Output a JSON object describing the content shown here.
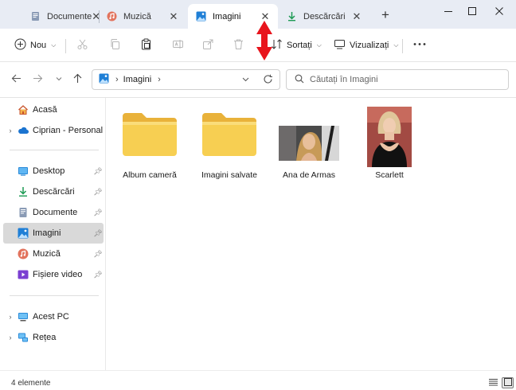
{
  "tabs": [
    {
      "label": "Documente",
      "icon": "documents-icon",
      "active": false
    },
    {
      "label": "Muzică",
      "icon": "music-icon",
      "active": false
    },
    {
      "label": "Imagini",
      "icon": "pictures-icon",
      "active": true
    },
    {
      "label": "Descărcări",
      "icon": "downloads-icon",
      "active": false
    }
  ],
  "toolbar": {
    "new_label": "Nou",
    "sort_label": "Sortați",
    "view_label": "Vizualizați"
  },
  "address": {
    "crumb": "Imagini"
  },
  "search": {
    "placeholder": "Căutați în Imagini"
  },
  "sidebar": {
    "items": [
      {
        "label": "Acasă",
        "icon": "home-icon"
      },
      {
        "label": "Ciprian - Personal",
        "icon": "onedrive-cloud-icon"
      },
      {
        "label": "Desktop",
        "icon": "desktop-icon"
      },
      {
        "label": "Descărcări",
        "icon": "downloads-icon"
      },
      {
        "label": "Documente",
        "icon": "documents-icon"
      },
      {
        "label": "Imagini",
        "icon": "pictures-icon",
        "selected": true
      },
      {
        "label": "Muzică",
        "icon": "music-icon"
      },
      {
        "label": "Fișiere video",
        "icon": "videos-icon"
      },
      {
        "label": "Acest PC",
        "icon": "this-pc-icon"
      },
      {
        "label": "Rețea",
        "icon": "network-icon"
      }
    ]
  },
  "files": [
    {
      "name": "Album cameră",
      "type": "folder"
    },
    {
      "name": "Imagini salvate",
      "type": "folder"
    },
    {
      "name": "Ana de Armas",
      "type": "image"
    },
    {
      "name": "Scarlett",
      "type": "image"
    }
  ],
  "status": {
    "count": "4 elemente"
  },
  "colors": {
    "tab_strip": "#e8ecf4",
    "selected_item": "#d9d9d9",
    "folder_yellow": "#f7cf52",
    "annotation_red": "#e8141c"
  }
}
